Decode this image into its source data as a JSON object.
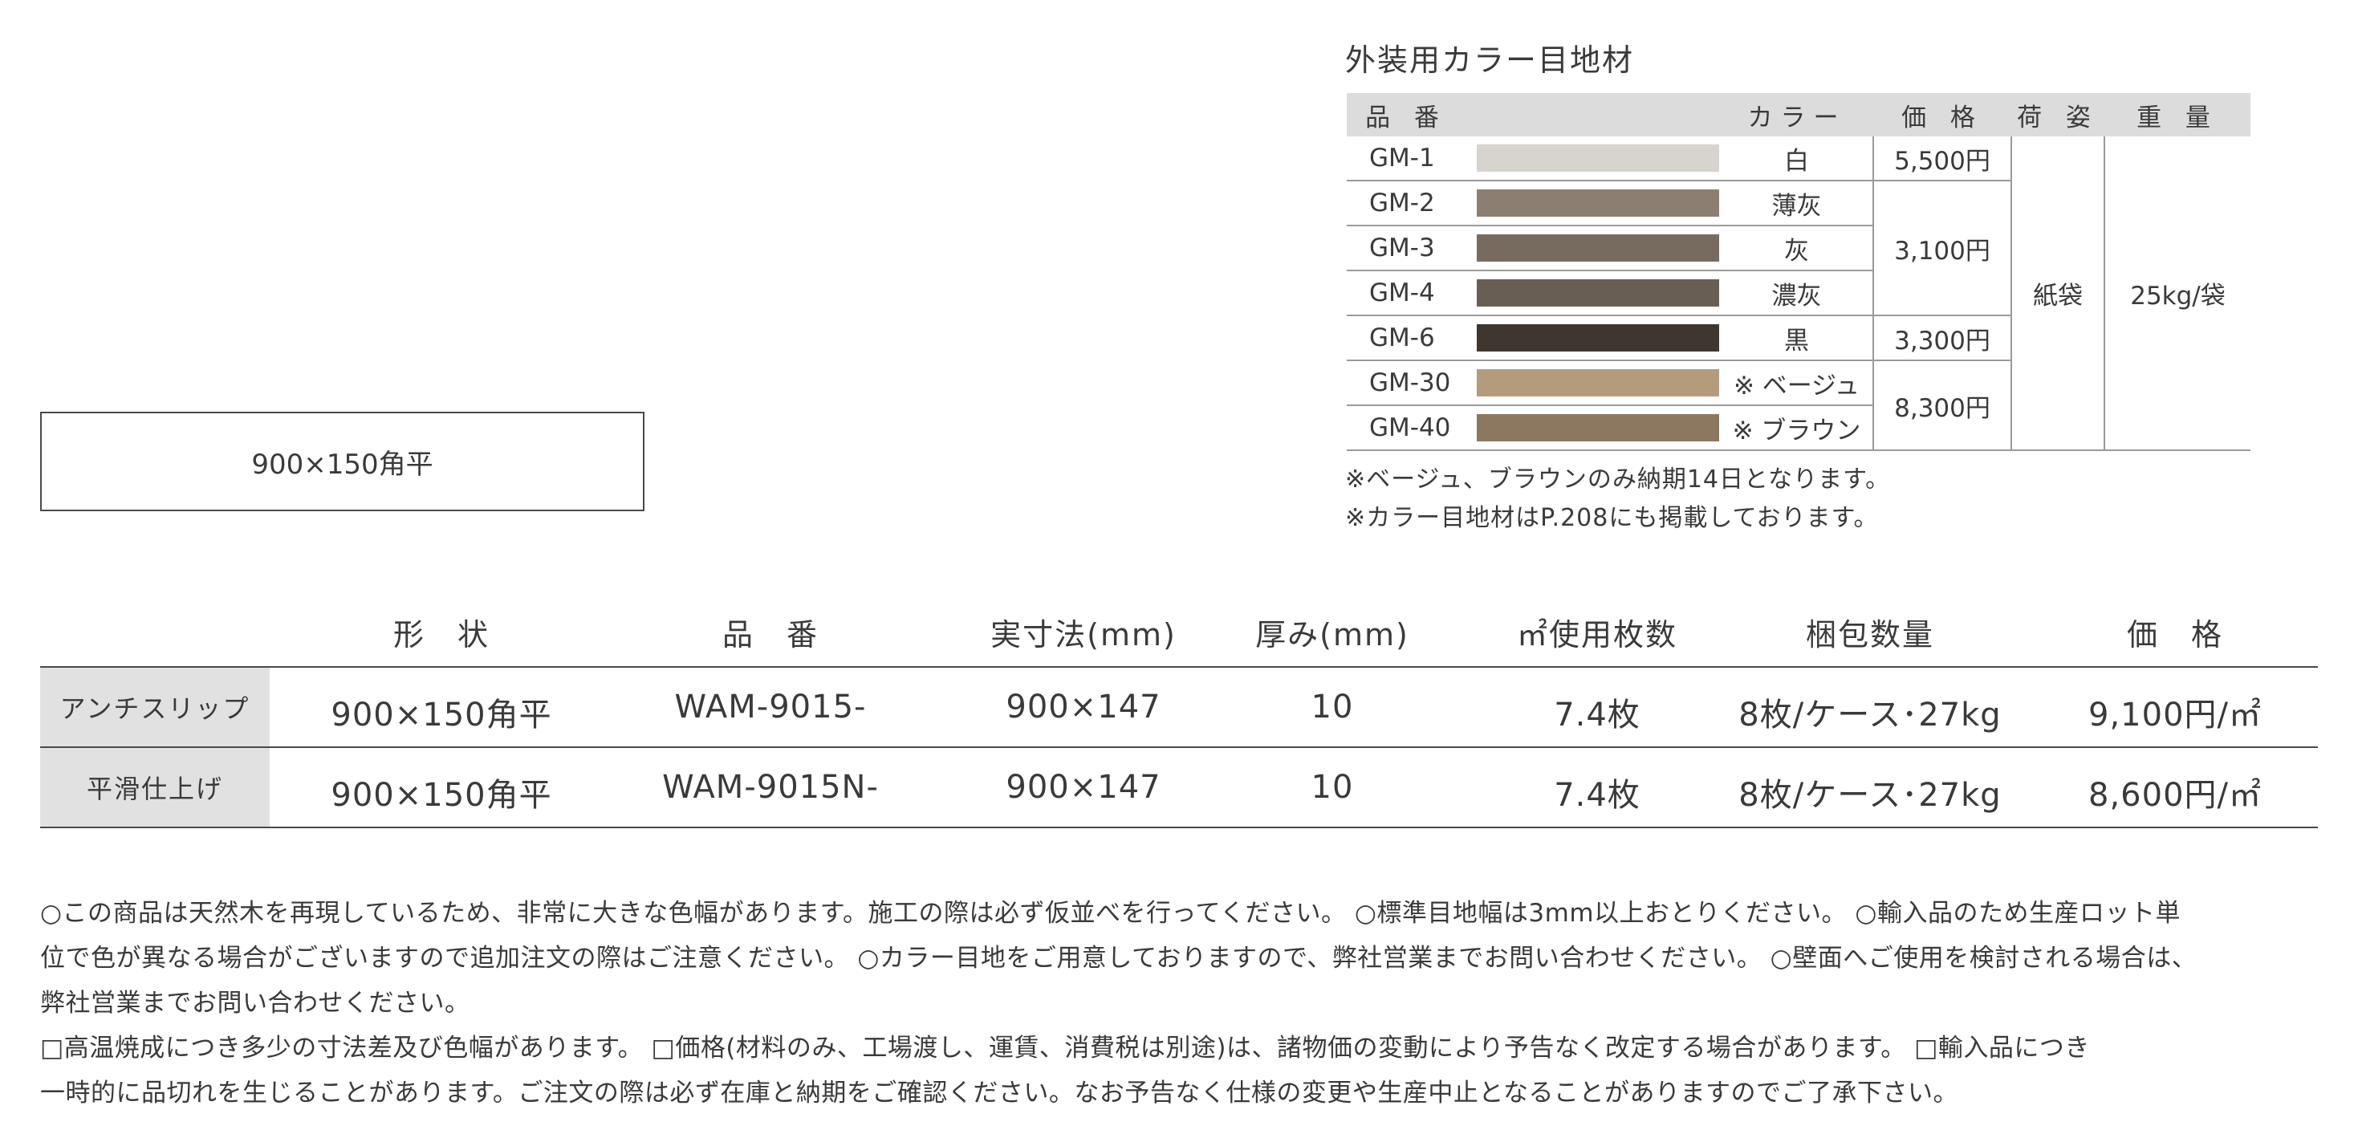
{
  "shape_label": "900×150角平",
  "joint_material": {
    "title": "外装用カラー目地材",
    "headers": {
      "code": "品 番",
      "color": "カラー",
      "price": "価 格",
      "packing": "荷 姿",
      "weight": "重 量"
    },
    "rows": [
      {
        "code": "GM-1",
        "swatch": "#d7d3ce",
        "color": "白",
        "price": "5,500円"
      },
      {
        "code": "GM-2",
        "swatch": "#8c7f72",
        "color": "薄灰",
        "price": ""
      },
      {
        "code": "GM-3",
        "swatch": "#776b60",
        "color": "灰",
        "price": "3,100円"
      },
      {
        "code": "GM-4",
        "swatch": "#695e53",
        "color": "濃灰",
        "price": ""
      },
      {
        "code": "GM-6",
        "swatch": "#3f3630",
        "color": "黒",
        "price": "3,300円"
      },
      {
        "code": "GM-30",
        "swatch": "#b39c7c",
        "color": "※ ベージュ",
        "price": "8,300円"
      },
      {
        "code": "GM-40",
        "swatch": "#8c7761",
        "color": "※ ブラウン",
        "price": ""
      }
    ],
    "packing": "紙袋",
    "weight": "25kg/袋",
    "notes": [
      "※ベージュ、ブラウンのみ納期14日となります。",
      "※カラー目地材はP.208にも掲載しております。"
    ]
  },
  "product_table": {
    "headers": {
      "shape": "形　状",
      "code": "品　番",
      "size": "実寸法(mm)",
      "thickness": "厚み(mm)",
      "per_sqm": "㎡使用枚数",
      "packing": "梱包数量",
      "price": "価　格"
    },
    "rows": [
      {
        "label": "アンチスリップ",
        "shape": "900×150角平",
        "code": "WAM-9015-",
        "size": "900×147",
        "thickness": "10",
        "per_sqm": "7.4枚",
        "packing": "8枚/ケース･27kg",
        "price": "9,100円/㎡"
      },
      {
        "label": "平滑仕上げ",
        "shape": "900×150角平",
        "code": "WAM-9015N-",
        "size": "900×147",
        "thickness": "10",
        "per_sqm": "7.4枚",
        "packing": "8枚/ケース･27kg",
        "price": "8,600円/㎡"
      }
    ]
  },
  "notes": [
    "○この商品は天然木を再現しているため、非常に大きな色幅があります。施工の際は必ず仮並べを行ってください。 ○標準目地幅は3mm以上おとりください。 ○輸入品のため生産ロット単",
    "位で色が異なる場合がございますので追加注文の際はご注意ください。 ○カラー目地をご用意しておりますので、弊社営業までお問い合わせください。 ○壁面へご使用を検討される場合は、",
    "弊社営業までお問い合わせください。",
    "□高温焼成につき多少の寸法差及び色幅があります。 □価格(材料のみ、工場渡し、運賃、消費税は別途)は、諸物価の変動により予告なく改定する場合があります。 □輸入品につき",
    "一時的に品切れを生じることがあります。ご注文の際は必ず在庫と納期をご確認ください。なお予告なく仕様の変更や生産中止となることがありますのでご了承下さい。"
  ]
}
